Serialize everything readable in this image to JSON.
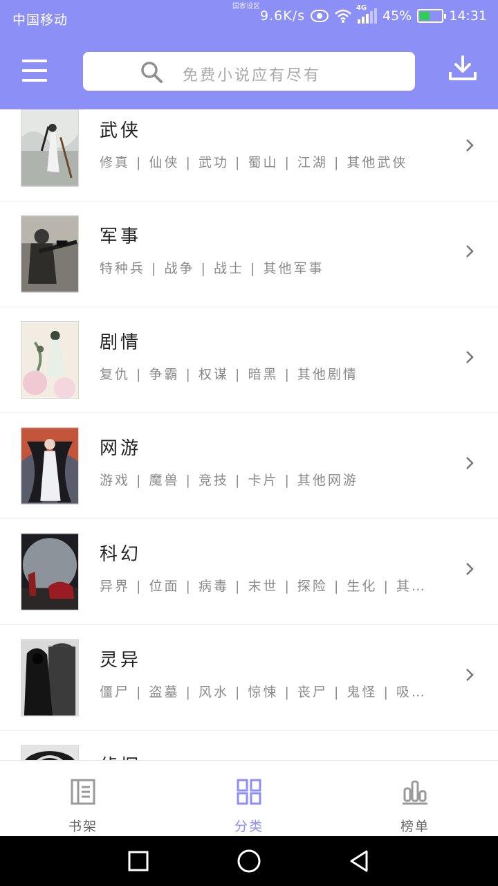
{
  "status_bar": {
    "carrier": "中国移动",
    "net_speed": "9.6K/s",
    "network_type": "4G",
    "battery": "45%",
    "time": "14:31",
    "tiny_label": "国家设区"
  },
  "header": {
    "menu_icon": "hamburger-icon",
    "search_icon": "search-icon",
    "search_placeholder": "免费小说应有尽有",
    "download_icon": "download-icon",
    "bar_color": "#8b8ff6"
  },
  "categories": [
    {
      "title": "武侠",
      "tags": "修真 | 仙侠 | 武功 | 蜀山 | 江湖 | 其他武侠"
    },
    {
      "title": "军事",
      "tags": "特种兵 | 战争 | 战士 | 其他军事"
    },
    {
      "title": "剧情",
      "tags": "复仇 | 争霸 | 权谋 | 暗黑 | 其他剧情"
    },
    {
      "title": "网游",
      "tags": "游戏 | 魔兽 | 竞技 | 卡片 | 其他网游"
    },
    {
      "title": "科幻",
      "tags": "异界 | 位面 | 病毒 | 末世 | 探险 | 生化 | 其…"
    },
    {
      "title": "灵异",
      "tags": "僵尸 | 盗墓 | 风水 | 惊悚 | 丧尸 | 鬼怪 | 吸…"
    },
    {
      "title": "侦探",
      "tags": ""
    }
  ],
  "bottom_nav": {
    "tabs": [
      {
        "label": "书架",
        "icon": "bookshelf-icon",
        "active": false
      },
      {
        "label": "分类",
        "icon": "category-grid-icon",
        "active": true
      },
      {
        "label": "榜单",
        "icon": "ranking-chart-icon",
        "active": false
      }
    ],
    "active_color": "#8b8ff6"
  },
  "system_nav": {
    "buttons": [
      "recent-apps-icon",
      "home-icon",
      "back-icon"
    ]
  }
}
